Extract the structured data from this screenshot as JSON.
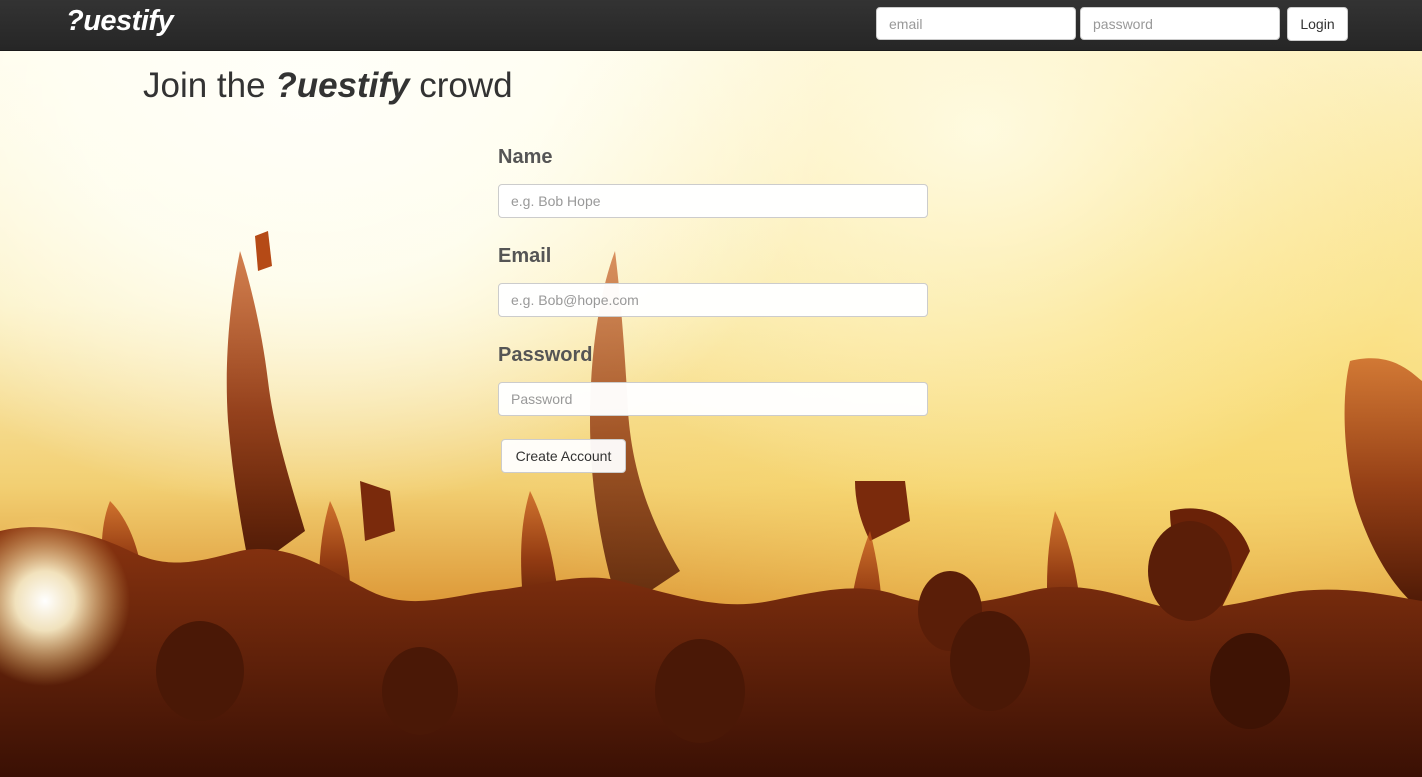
{
  "navbar": {
    "brand": "?uestify",
    "email_placeholder": "email",
    "password_placeholder": "password",
    "login_label": "Login"
  },
  "page": {
    "title_prefix": "Join the ",
    "title_brand": "?uestify",
    "title_suffix": " crowd"
  },
  "signup_form": {
    "name_label": "Name",
    "name_placeholder": "e.g. Bob Hope",
    "email_label": "Email",
    "email_placeholder": "e.g. Bob@hope.com",
    "password_label": "Password",
    "password_placeholder": "Password",
    "submit_label": "Create Account"
  },
  "background": {
    "description_icon": "concert-crowd-image",
    "colors": {
      "light": "#fffbe8",
      "mid": "#f2cf72",
      "dark": "#a9541a",
      "silhouette": "#5a1e08"
    }
  }
}
